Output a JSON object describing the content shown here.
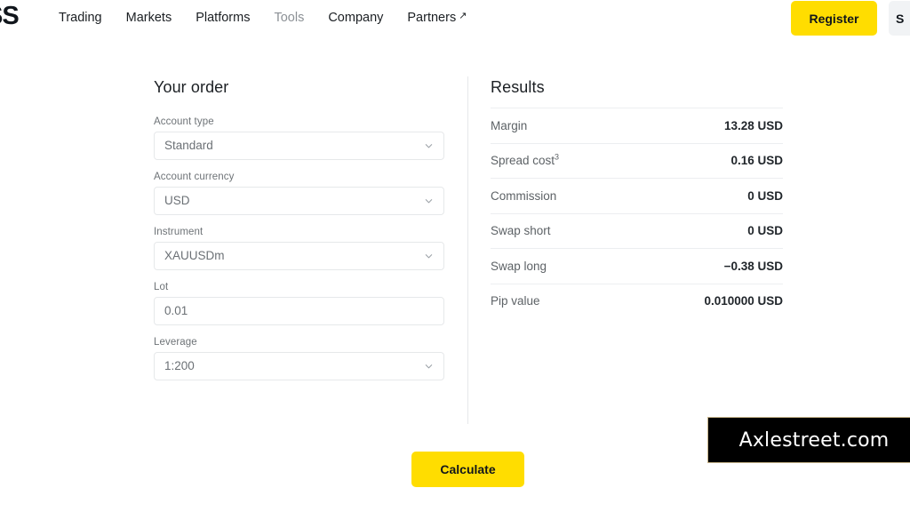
{
  "header": {
    "logo_text": "SS",
    "nav_items": [
      {
        "label": "Trading",
        "muted": false,
        "external": false
      },
      {
        "label": "Markets",
        "muted": false,
        "external": false
      },
      {
        "label": "Platforms",
        "muted": false,
        "external": false
      },
      {
        "label": "Tools",
        "muted": true,
        "external": false
      },
      {
        "label": "Company",
        "muted": false,
        "external": false
      },
      {
        "label": "Partners",
        "muted": false,
        "external": true
      }
    ],
    "external_arrow_glyph": "↗",
    "register_label": "Register",
    "secondary_button_label": "S",
    "accent_color": "#ffdd00"
  },
  "order": {
    "title": "Your order",
    "fields": [
      {
        "label": "Account type",
        "value": "Standard",
        "control": "select",
        "icon": "chevron-down-icon",
        "name": "account-type"
      },
      {
        "label": "Account currency",
        "value": "USD",
        "control": "select",
        "icon": "chevron-down-icon",
        "name": "account-currency"
      },
      {
        "label": "Instrument",
        "value": "XAUUSDm",
        "control": "select",
        "icon": "chevron-down-icon",
        "name": "instrument"
      },
      {
        "label": "Lot",
        "value": "0.01",
        "control": "input",
        "icon": "",
        "name": "lot"
      },
      {
        "label": "Leverage",
        "value": "1:200",
        "control": "select",
        "icon": "chevron-down-icon",
        "name": "leverage"
      }
    ]
  },
  "results": {
    "title": "Results",
    "rows": [
      {
        "label": "Margin",
        "superscript": "",
        "value": "13.28 USD"
      },
      {
        "label": "Spread cost",
        "superscript": "3",
        "value": "0.16 USD"
      },
      {
        "label": "Commission",
        "superscript": "",
        "value": "0 USD"
      },
      {
        "label": "Swap short",
        "superscript": "",
        "value": "0 USD"
      },
      {
        "label": "Swap long",
        "superscript": "",
        "value": "−0.38 USD"
      },
      {
        "label": "Pip value",
        "superscript": "",
        "value": "0.010000 USD"
      }
    ]
  },
  "actions": {
    "calculate_label": "Calculate"
  },
  "watermark": {
    "text": "Axlestreet.com"
  }
}
